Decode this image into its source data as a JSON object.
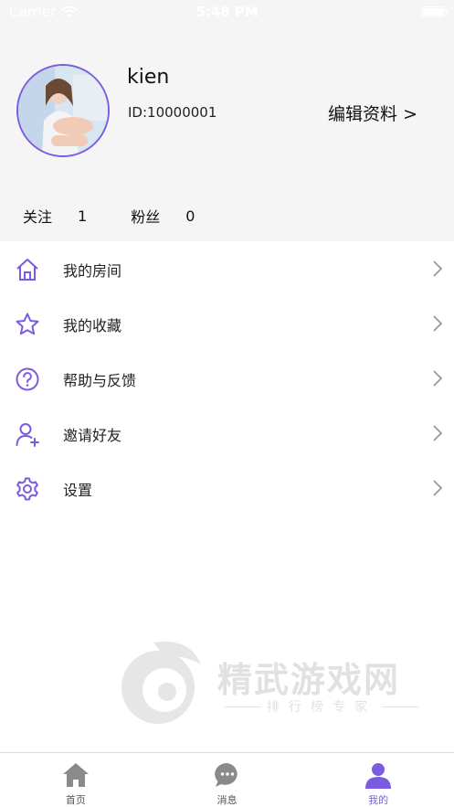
{
  "status_bar": {
    "carrier": "Carrier",
    "time": "5:48 PM"
  },
  "profile": {
    "username": "kien",
    "user_id": "ID:10000001",
    "edit_label": "编辑资料 >",
    "stats": [
      {
        "label": "关注",
        "value": "1"
      },
      {
        "label": "粉丝",
        "value": "0"
      }
    ]
  },
  "menu": {
    "items": [
      {
        "label": "我的房间",
        "icon": "home-icon"
      },
      {
        "label": "我的收藏",
        "icon": "star-icon"
      },
      {
        "label": "帮助与反馈",
        "icon": "help-icon"
      },
      {
        "label": "邀请好友",
        "icon": "add-user-icon"
      },
      {
        "label": "设置",
        "icon": "gear-icon"
      }
    ]
  },
  "watermark": {
    "title": "精武游戏网",
    "subtitle": "排行榜专家"
  },
  "tab_bar": {
    "tabs": [
      {
        "label": "首页",
        "icon": "home-icon"
      },
      {
        "label": "消息",
        "icon": "chat-icon"
      },
      {
        "label": "我的",
        "icon": "user-icon"
      }
    ],
    "active_index": 2
  },
  "colors": {
    "accent": "#7b5ce0",
    "header_bg": "#f5f5f5",
    "icon_gray": "#8a8a8a"
  }
}
